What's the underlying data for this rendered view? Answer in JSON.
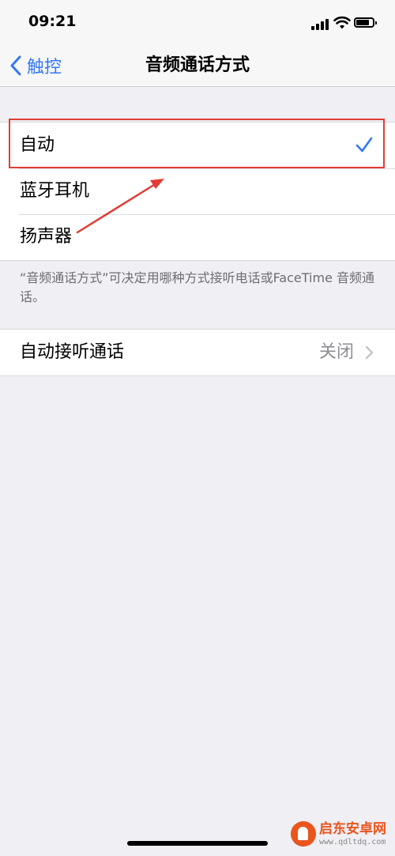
{
  "status_bar": {
    "time": "09:21"
  },
  "nav": {
    "back_label": "触控",
    "title": "音频通话方式"
  },
  "audio_routing": {
    "options": [
      {
        "label": "自动",
        "selected": true
      },
      {
        "label": "蓝牙耳机",
        "selected": false
      },
      {
        "label": "扬声器",
        "selected": false
      }
    ],
    "footer": "“音频通话方式”可决定用哪种方式接听电话或FaceTime 音频通话。"
  },
  "auto_answer": {
    "label": "自动接听通话",
    "value": "关闭"
  },
  "watermark": {
    "name": "启东安卓网",
    "url": "www.qdltdq.com"
  },
  "colors": {
    "accent": "#3478f6",
    "annotation": "#e23c35",
    "background": "#efeff4"
  },
  "icons": [
    "chevron-left-icon",
    "checkmark-icon",
    "chevron-right-icon",
    "signal-icon",
    "wifi-icon",
    "battery-icon"
  ]
}
